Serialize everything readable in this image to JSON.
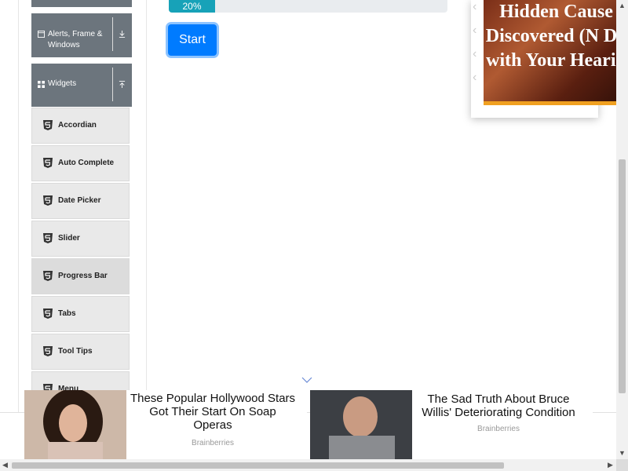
{
  "sidebar": {
    "groups": [
      {
        "label": "Alerts, Frame & Windows"
      },
      {
        "label": "Widgets"
      }
    ],
    "items": [
      {
        "label": "Accordian"
      },
      {
        "label": "Auto Complete"
      },
      {
        "label": "Date Picker"
      },
      {
        "label": "Slider"
      },
      {
        "label": "Progress Bar"
      },
      {
        "label": "Tabs"
      },
      {
        "label": "Tool Tips"
      },
      {
        "label": "Menu"
      }
    ],
    "active_item": "Progress Bar"
  },
  "progress": {
    "value": 20,
    "label": "20%",
    "color": "#17a2b8"
  },
  "start_button": {
    "label": "Start",
    "color": "#007bff"
  },
  "ad_top": {
    "headline": "Hidden Cause Discovered (N Do with Your Hearin"
  },
  "bottom_ads": [
    {
      "title": "These Popular Hollywood Stars Got Their Start On Soap Operas",
      "source": "Brainberries"
    },
    {
      "title": "The Sad Truth About Bruce Willis' Deteriorating Condition",
      "source": "Brainberries"
    }
  ]
}
